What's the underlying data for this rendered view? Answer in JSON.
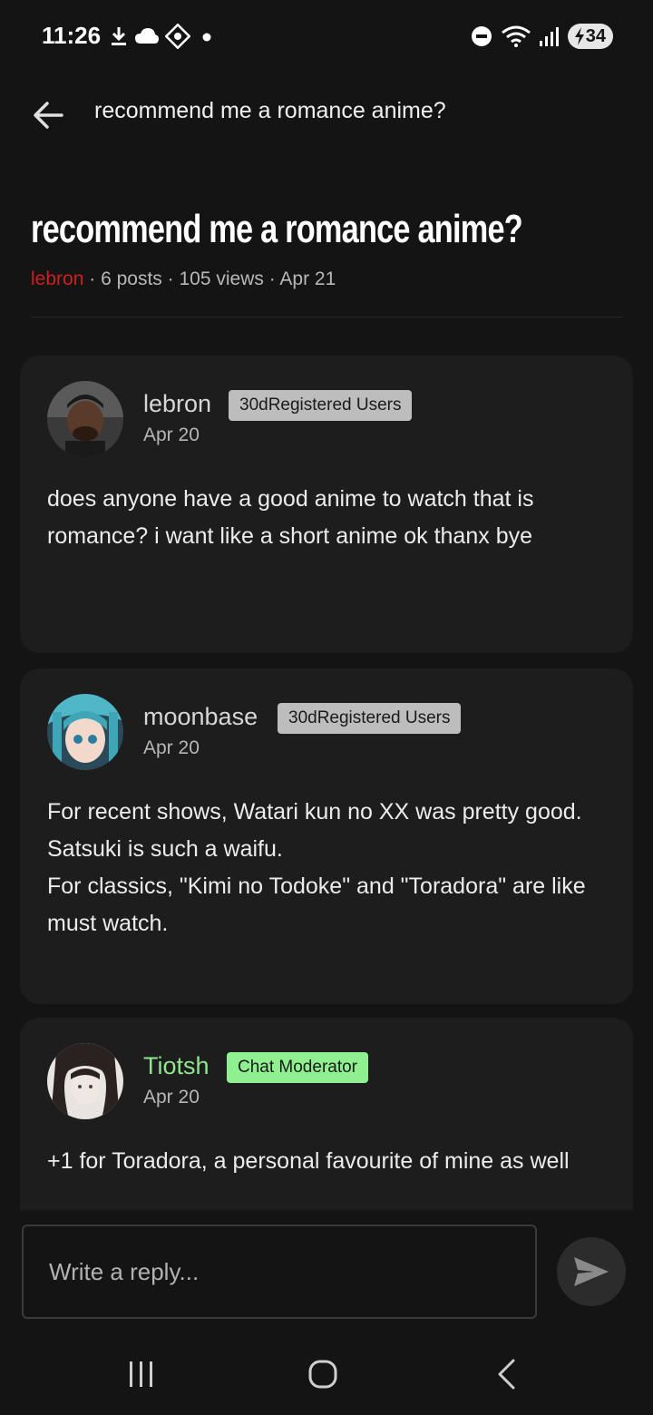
{
  "status_bar": {
    "time": "11:26",
    "battery": "34",
    "icons": [
      "download-icon",
      "cloud-icon",
      "app-icon",
      "dot-icon",
      "dnd-icon",
      "wifi-icon",
      "signal-icon",
      "battery-charging-icon"
    ]
  },
  "top_bar": {
    "title": "recommend me a romance anime?",
    "back_icon": "arrow-left-icon"
  },
  "thread": {
    "title": "recommend me a romance anime?",
    "author": "lebron",
    "posts": "6 posts",
    "views": "105 views",
    "date": "Apr 21",
    "separator": "·"
  },
  "posts": [
    {
      "username": "lebron",
      "badge": "30dRegistered Users",
      "date": "Apr 20",
      "lines": [
        "does anyone have a good anime to watch that is romance? i want like a short anime ok thanx bye"
      ]
    },
    {
      "username": "moonbase",
      "badge": "30dRegistered Users",
      "date": "Apr 20",
      "lines": [
        "For recent shows, Watari kun no XX was pretty good. Satsuki is such a waifu.",
        "For classics, \"Kimi no Todoke\" and \"Toradora\" are like must watch."
      ]
    },
    {
      "username": "Tiotsh",
      "badge": "Chat Moderator",
      "date": "Apr 20",
      "lines": [
        "+1 for Toradora, a personal favourite of mine as well"
      ]
    }
  ],
  "composer": {
    "placeholder": "Write a reply...",
    "send_icon": "send-icon"
  },
  "colors": {
    "background": "#141414",
    "card": "#1d1d1d",
    "author_red": "#d11f1f",
    "moderator_green": "#8ef08e",
    "badge_gray": "#bdbdbd"
  },
  "nav_bar": {
    "icons": [
      "recents-icon",
      "home-icon",
      "back-icon"
    ]
  }
}
